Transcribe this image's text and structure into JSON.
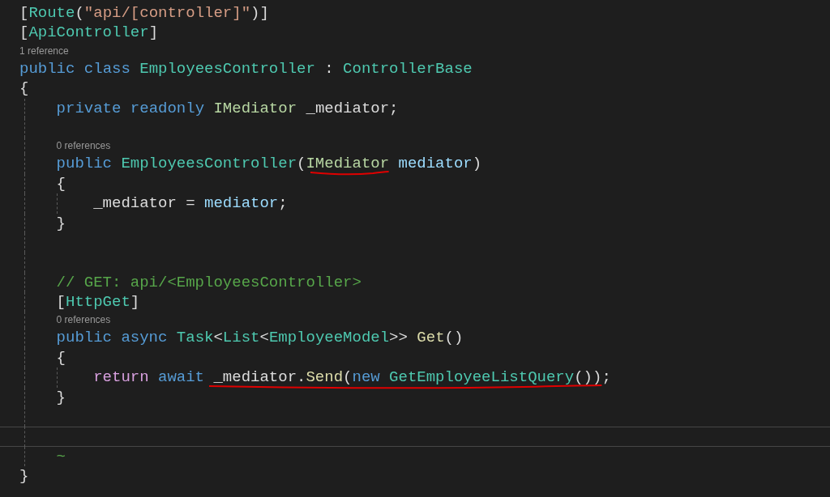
{
  "editor": {
    "lines": [
      {
        "kind": "code",
        "tokens": [
          {
            "text": "[",
            "kind": "plain"
          },
          {
            "text": "Route",
            "kind": "type"
          },
          {
            "text": "(",
            "kind": "plain"
          },
          {
            "text": "\"api/[controller]\"",
            "kind": "string"
          },
          {
            "text": ")]",
            "kind": "plain"
          }
        ]
      },
      {
        "kind": "code",
        "tokens": [
          {
            "text": "[",
            "kind": "plain"
          },
          {
            "text": "ApiController",
            "kind": "type"
          },
          {
            "text": "]",
            "kind": "plain"
          }
        ]
      },
      {
        "kind": "lens",
        "text": "1 reference"
      },
      {
        "kind": "code",
        "tokens": [
          {
            "text": "public",
            "kind": "keyword"
          },
          {
            "text": " class",
            "kind": "keyword"
          },
          {
            "text": " EmployeesController",
            "kind": "type"
          },
          {
            "text": " :",
            "kind": "plain"
          },
          {
            "text": " ControllerBase",
            "kind": "type"
          }
        ]
      },
      {
        "kind": "code",
        "tokens": [
          {
            "text": "{",
            "kind": "plain"
          }
        ]
      },
      {
        "kind": "block",
        "children": [
          {
            "kind": "code",
            "tokens": [
              {
                "text": "private",
                "kind": "keyword"
              },
              {
                "text": " readonly",
                "kind": "keyword"
              },
              {
                "text": " IMediator",
                "kind": "interface"
              },
              {
                "text": " _mediator;",
                "kind": "plain"
              }
            ]
          },
          {
            "kind": "blank"
          },
          {
            "kind": "lens",
            "text": "0 references"
          },
          {
            "kind": "code",
            "tokens": [
              {
                "text": "public",
                "kind": "keyword"
              },
              {
                "text": " EmployeesController",
                "kind": "type"
              },
              {
                "text": "(",
                "kind": "plain"
              },
              {
                "kind": "underlined",
                "tokens": [
                  {
                    "text": "IMediator",
                    "kind": "interface"
                  }
                ]
              },
              {
                "text": " mediator",
                "kind": "param"
              },
              {
                "text": ")",
                "kind": "plain"
              }
            ]
          },
          {
            "kind": "code",
            "tokens": [
              {
                "text": "{",
                "kind": "plain"
              }
            ]
          },
          {
            "kind": "block",
            "children": [
              {
                "kind": "code",
                "tokens": [
                  {
                    "text": "_mediator",
                    "kind": "plain"
                  },
                  {
                    "text": " =",
                    "kind": "plain"
                  },
                  {
                    "text": " mediator",
                    "kind": "param"
                  },
                  {
                    "text": ";",
                    "kind": "plain"
                  }
                ]
              }
            ]
          },
          {
            "kind": "code",
            "tokens": [
              {
                "text": "}",
                "kind": "plain"
              }
            ]
          },
          {
            "kind": "blank"
          },
          {
            "kind": "blank"
          },
          {
            "kind": "code",
            "tokens": [
              {
                "text": "// GET: api/<EmployeesController>",
                "kind": "comment"
              }
            ]
          },
          {
            "kind": "code",
            "tokens": [
              {
                "text": "[",
                "kind": "plain"
              },
              {
                "text": "HttpGet",
                "kind": "type"
              },
              {
                "text": "]",
                "kind": "plain"
              }
            ]
          },
          {
            "kind": "lens",
            "text": "0 references"
          },
          {
            "kind": "code",
            "tokens": [
              {
                "text": "public",
                "kind": "keyword"
              },
              {
                "text": " async",
                "kind": "keyword"
              },
              {
                "text": " Task",
                "kind": "type"
              },
              {
                "text": "<",
                "kind": "plain"
              },
              {
                "text": "List",
                "kind": "type"
              },
              {
                "text": "<",
                "kind": "plain"
              },
              {
                "text": "EmployeeModel",
                "kind": "type"
              },
              {
                "text": ">>",
                "kind": "plain"
              },
              {
                "text": " Get",
                "kind": "method"
              },
              {
                "text": "()",
                "kind": "plain"
              }
            ]
          },
          {
            "kind": "code",
            "tokens": [
              {
                "text": "{",
                "kind": "plain"
              }
            ]
          },
          {
            "kind": "block",
            "children": [
              {
                "kind": "code",
                "tokens": [
                  {
                    "text": "return",
                    "kind": "control"
                  },
                  {
                    "text": " await",
                    "kind": "keyword"
                  },
                  {
                    "kind": "underlined",
                    "tokens": [
                      {
                        "text": " _mediator",
                        "kind": "plain"
                      },
                      {
                        "text": ".",
                        "kind": "plain"
                      },
                      {
                        "text": "Send",
                        "kind": "method"
                      },
                      {
                        "text": "(",
                        "kind": "plain"
                      },
                      {
                        "text": "new",
                        "kind": "keyword"
                      },
                      {
                        "text": " GetEmployeeListQuery",
                        "kind": "type"
                      },
                      {
                        "text": "())",
                        "kind": "plain"
                      }
                    ]
                  },
                  {
                    "text": ";",
                    "kind": "plain"
                  }
                ]
              }
            ]
          },
          {
            "kind": "code",
            "tokens": [
              {
                "text": "}",
                "kind": "plain"
              }
            ]
          },
          {
            "kind": "blank"
          },
          {
            "kind": "blank",
            "current": true
          },
          {
            "kind": "code",
            "tokens": [
              {
                "text": "~",
                "kind": "tilde"
              }
            ]
          }
        ]
      },
      {
        "kind": "code",
        "tokens": [
          {
            "text": "}",
            "kind": "plain"
          }
        ]
      }
    ]
  }
}
